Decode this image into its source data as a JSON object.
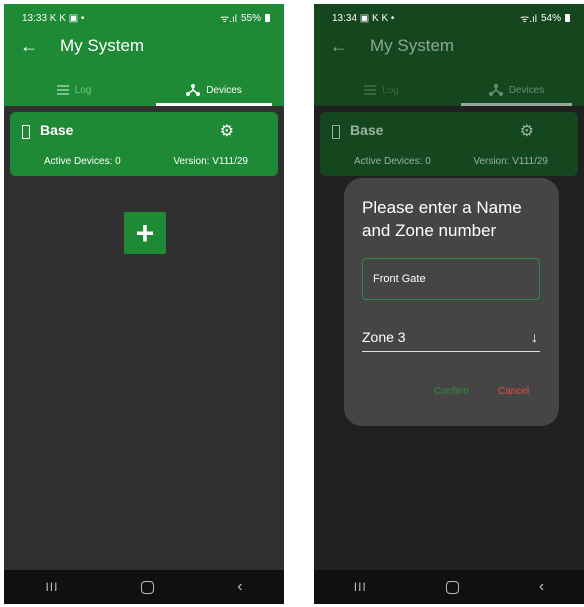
{
  "colors": {
    "primary_green": "#1f8a35",
    "dark_body": "#303030",
    "dialog_bg": "#454545",
    "confirm_green": "#2b8f3b",
    "cancel_red": "#e0503d"
  },
  "screen_left": {
    "status": {
      "time": "13:33 K K ▣ •",
      "signal": "ᯤ.ıl",
      "battery": "55%"
    },
    "title": "My System",
    "back_icon": "arrow-left-icon",
    "tabs": [
      {
        "label": "Log",
        "icon": "list-icon",
        "active": false
      },
      {
        "label": "Devices",
        "icon": "hub-icon",
        "active": true
      }
    ],
    "base_card": {
      "label": "Base",
      "active_devices": "Active Devices: 0",
      "version": "Version: V111/29"
    },
    "add_button_label": "+",
    "nav": {
      "recents": "III",
      "back": "‹"
    }
  },
  "screen_right": {
    "status": {
      "time": "13:34 ▣ K K •",
      "signal": "ᯤ.ıl",
      "battery": "54%"
    },
    "title": "My System",
    "tabs": [
      {
        "label": "Log",
        "icon": "list-icon",
        "active": false
      },
      {
        "label": "Devices",
        "icon": "hub-icon",
        "active": true
      }
    ],
    "base_card": {
      "label": "Base",
      "active_devices": "Active Devices: 0",
      "version": "Version: V111/29"
    },
    "dialog": {
      "title": "Please enter a Name and Zone number",
      "name_value": "Front Gate",
      "zone_value": "Zone 3",
      "confirm": "Confirm",
      "cancel": "Cancel"
    },
    "nav": {
      "recents": "III",
      "back": "‹"
    }
  }
}
